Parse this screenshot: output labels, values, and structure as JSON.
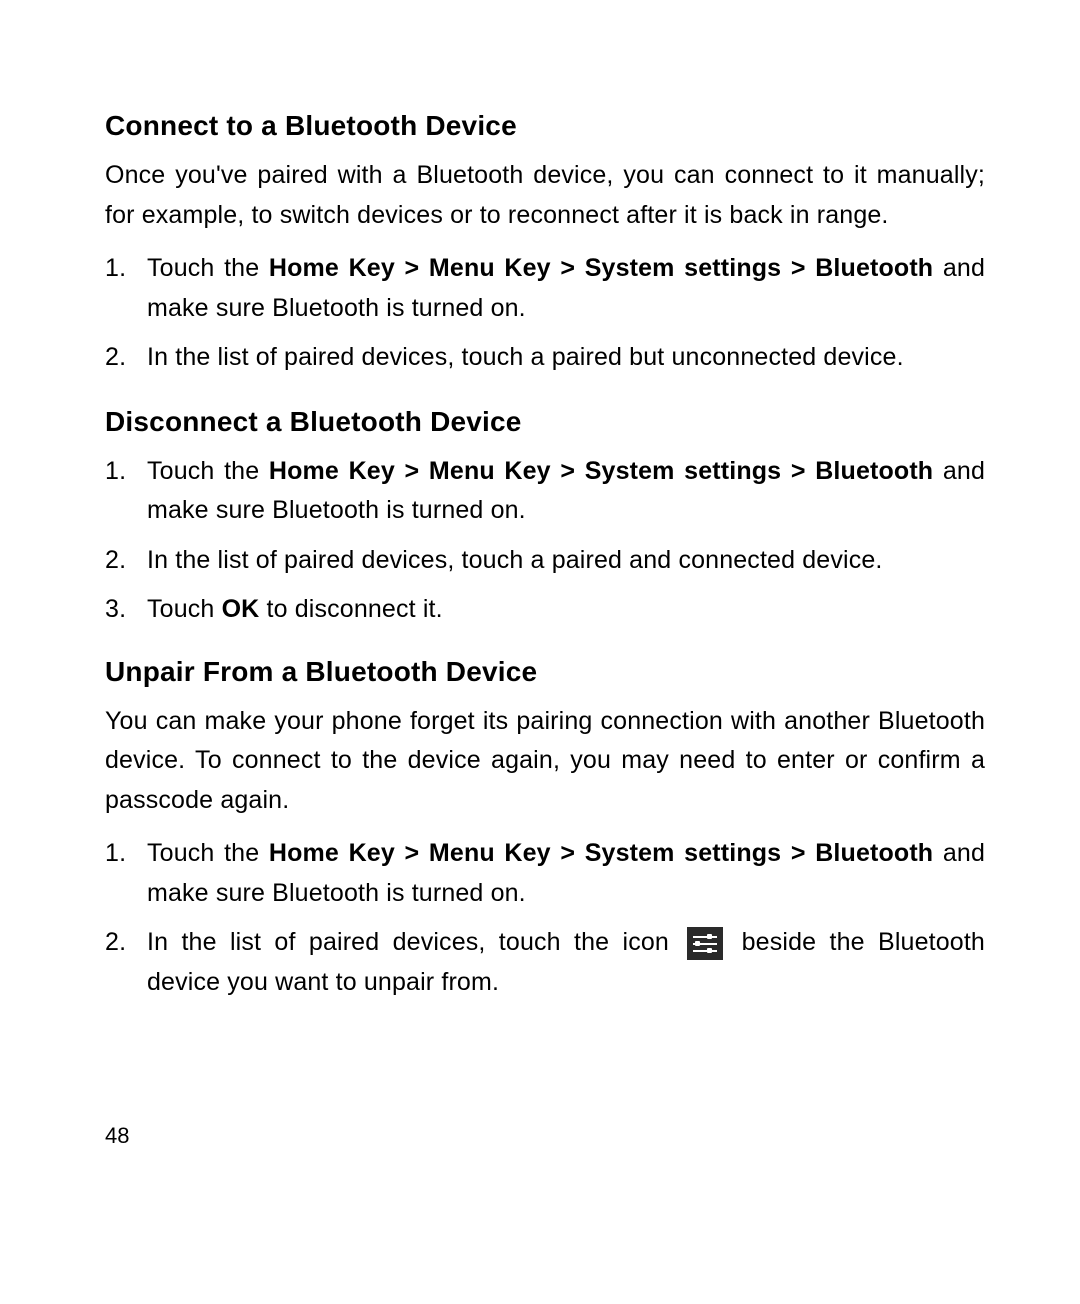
{
  "sections": {
    "connect": {
      "heading": "Connect to a Bluetooth Device",
      "intro": "Once you've paired with a Bluetooth device, you can connect to it manually; for example, to switch devices or to reconnect after it is back in range.",
      "step1_prefix": "Touch the ",
      "step1_bold": "Home Key > Menu Key > System settings > Bluetooth",
      "step1_suffix": " and make sure Bluetooth is turned on.",
      "step2": "In the list of paired devices, touch a paired but unconnected device."
    },
    "disconnect": {
      "heading": "Disconnect a Bluetooth Device",
      "step1_prefix": "Touch the ",
      "step1_bold": "Home Key > Menu Key > System settings > Bluetooth",
      "step1_suffix": " and make sure Bluetooth is turned on.",
      "step2": "In the list of paired devices, touch a paired and connected device.",
      "step3_prefix": "Touch ",
      "step3_bold": "OK",
      "step3_suffix": " to disconnect it."
    },
    "unpair": {
      "heading": "Unpair From a Bluetooth Device",
      "intro": "You can make your phone forget its pairing connection with another Bluetooth device. To connect to the device again, you may need to enter or confirm a passcode again.",
      "step1_prefix": "Touch the ",
      "step1_bold": "Home Key > Menu Key > System settings > Bluetooth",
      "step1_suffix": " and make sure Bluetooth is turned on.",
      "step2_prefix": "In the list of paired devices, touch the icon ",
      "step2_suffix": " beside the Bluetooth device you want to unpair from."
    }
  },
  "page_number": "48"
}
